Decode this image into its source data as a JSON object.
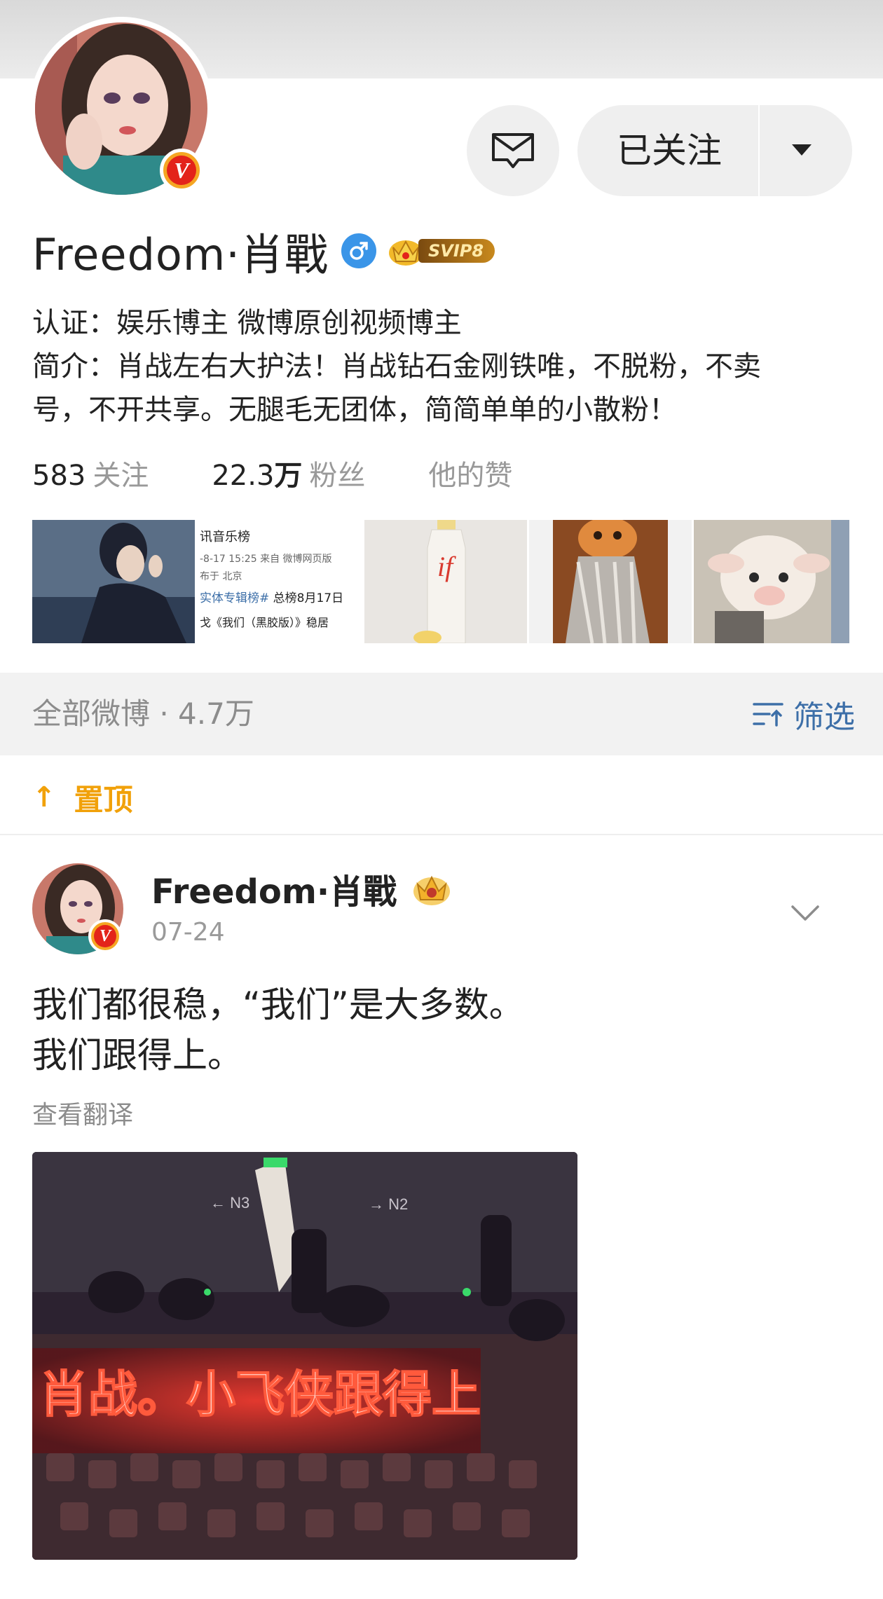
{
  "profile": {
    "name": "Freedom·肖戰",
    "gender_icon": "male-icon",
    "vip_badge": "SVIP8",
    "message_button_icon": "envelope-icon",
    "follow_label": "已关注",
    "certification": "认证：娱乐博主 微博原创视频博主",
    "intro_line1": "简介：肖战左右大护法！肖战钻石金刚铁唯，不脱粉，不卖",
    "intro_line2": "号，不开共享。无腿毛无团体，简简单单的小散粉！",
    "stats": {
      "following_num": "583",
      "following_label": "关注",
      "followers_num": "22.3",
      "followers_unit": "万",
      "followers_label": "粉丝",
      "likes_label": "他的赞"
    },
    "thumb2": {
      "line1": "讯音乐榜",
      "line2": "-8-17 15:25  来自 微博网页版",
      "line3": "布于 北京",
      "line4": "实体专辑榜#",
      "line4b": "总榜8月17日",
      "line5": "戈《我们（黑胶版）》稳居"
    }
  },
  "feed": {
    "section_title": "全部微博 · 4.7万",
    "filter_label": "筛选",
    "pinned_label": "置顶",
    "post": {
      "author": "Freedom·肖戰",
      "date": "07-24",
      "text_line1": "我们都很稳，“我们”是大多数。",
      "text_line2": "我们跟得上。",
      "translate_label": "查看翻译",
      "image_sign_left": "← N3",
      "image_sign_right": "→ N2",
      "banner_text": "肖战。小飞侠跟得上"
    }
  },
  "colors": {
    "accent_blue": "#3d6fa8",
    "pinned_orange": "#f1a10a",
    "verified_red": "#e3231a",
    "male_blue": "#3a95e8"
  }
}
